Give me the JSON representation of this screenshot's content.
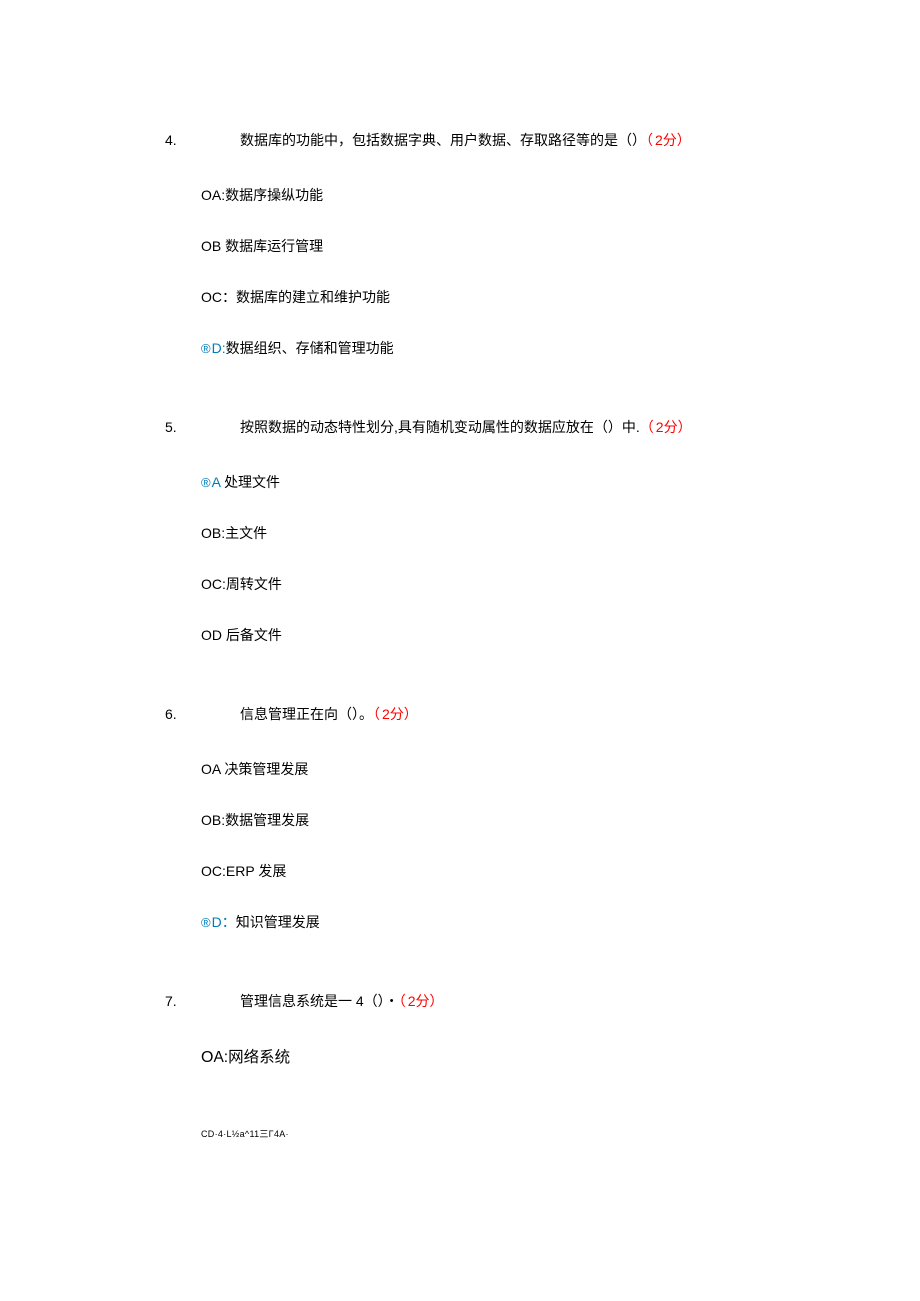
{
  "questions": [
    {
      "number": "4.",
      "text": "数据库的功能中，包括数据字典、用户数据、存取路径等的是（）",
      "points_open": "（",
      "points": "2分）",
      "options": [
        {
          "prefix": "O",
          "letter": "A:",
          "text": "数据序操纵功能",
          "selected": false
        },
        {
          "prefix": "O",
          "letter": "B ",
          "text": "数据库运行管理",
          "selected": false
        },
        {
          "prefix": "O",
          "letter": "C：",
          "text": "数据库的建立和维护功能",
          "selected": false
        },
        {
          "prefix": "®",
          "letter": "D:",
          "text": "数据组织、存储和管理功能",
          "selected": true
        }
      ]
    },
    {
      "number": "5.",
      "text": "按照数据的动态特性划分,具有随机变动属性的数据应放在（）中.",
      "points_open": "（",
      "points": "2分）",
      "options": [
        {
          "prefix": "®",
          "letter": "A ",
          "text": "处理文件",
          "selected": true
        },
        {
          "prefix": "O",
          "letter": "B:",
          "text": "主文件",
          "selected": false
        },
        {
          "prefix": "O",
          "letter": "C:",
          "text": "周转文件",
          "selected": false
        },
        {
          "prefix": "O",
          "letter": "D ",
          "text": "后备文件",
          "selected": false
        }
      ]
    },
    {
      "number": "6.",
      "text": "信息管理正在向（）。",
      "points_open": "（",
      "points": "2分）",
      "options": [
        {
          "prefix": "O",
          "letter": "A ",
          "text": "决策管理发展",
          "selected": false
        },
        {
          "prefix": "O",
          "letter": "B:",
          "text": "数据管理发展",
          "selected": false
        },
        {
          "prefix": "O",
          "letter": "C:",
          "text": "ERP 发展",
          "selected": false
        },
        {
          "prefix": "®",
          "letter": "D：",
          "text": "知识管理发展",
          "selected": true
        }
      ]
    },
    {
      "number": "7.",
      "text": "管理信息系统是一 4（）・",
      "points_open": "（",
      "points": "2分）",
      "options": [
        {
          "prefix": "O",
          "letter": "A:",
          "text": "网络系统",
          "selected": false,
          "large": true
        }
      ]
    }
  ],
  "footer_code": "CD·4·L½a^11三Γ4A·"
}
